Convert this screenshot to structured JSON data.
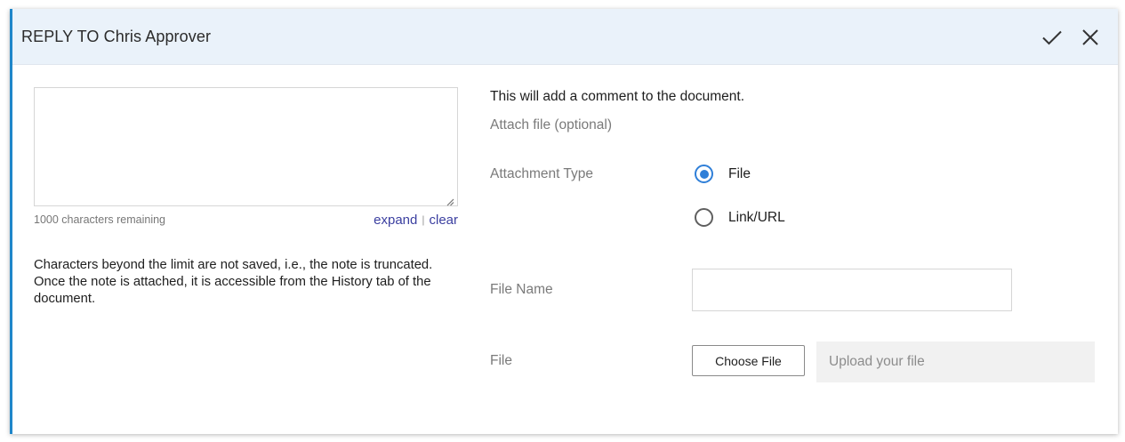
{
  "header": {
    "title": "REPLY TO Chris Approver",
    "confirm_icon": "checkmark-icon",
    "close_icon": "close-icon"
  },
  "note": {
    "value": "",
    "chars_remaining": "1000 characters remaining",
    "expand_label": "expand",
    "separator": "|",
    "clear_label": "clear",
    "truncate_info": "Characters beyond the limit are not saved, i.e., the note is truncated. Once the note is attached, it is accessible from the History tab of the document."
  },
  "attachment": {
    "notice": "This will add a comment to the document.",
    "heading": "Attach file (optional)",
    "type_label": "Attachment Type",
    "options": [
      {
        "label": "File",
        "selected": true
      },
      {
        "label": "Link/URL",
        "selected": false
      }
    ],
    "file_name_label": "File Name",
    "file_name_value": "",
    "file_label": "File",
    "choose_button": "Choose File",
    "upload_placeholder": "Upload your file"
  },
  "colors": {
    "accent": "#1f86c9",
    "header_bg": "#eaf2fa",
    "radio_selected": "#2f7fd8",
    "link": "#3b3fa0"
  }
}
